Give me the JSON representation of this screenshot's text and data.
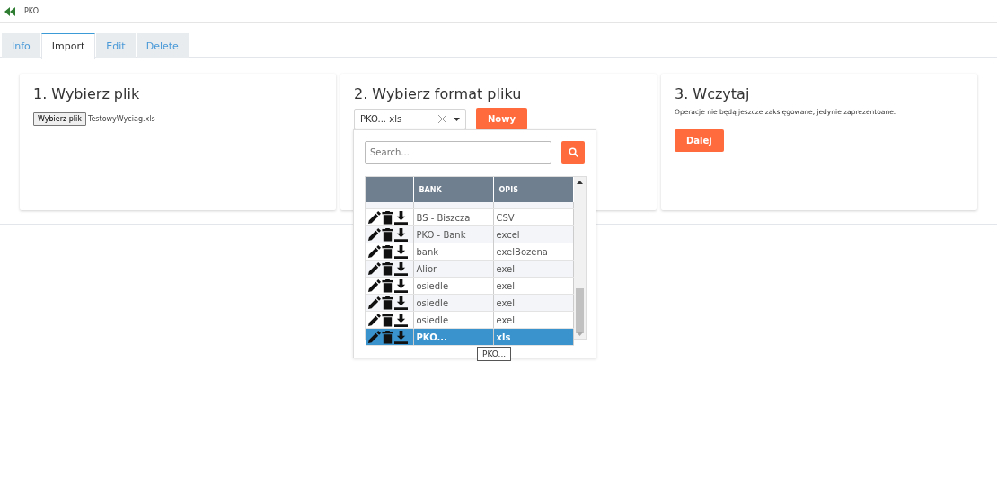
{
  "header": {
    "title": "PKO..."
  },
  "tabs": [
    {
      "label": "Info",
      "selected": false
    },
    {
      "label": "Import",
      "selected": true
    },
    {
      "label": "Edit",
      "selected": false
    },
    {
      "label": "Delete",
      "selected": false
    }
  ],
  "cards": [
    {
      "kind": "file",
      "title": "1. Wybierz plik",
      "button": "Wybierz plik",
      "file_name": "TestowyWyciag.xls"
    },
    {
      "kind": "format",
      "title": "2. Wybierz format pliku",
      "select_value": "PKO... xls",
      "button": "Nowy"
    },
    {
      "kind": "load",
      "title": "3. Wczytaj",
      "note": "Operacje nie będą jeszcze zaksięgowane, jedynie zaprezentoane.",
      "button": "Dalej"
    }
  ],
  "dropdown": {
    "search_placeholder": "Search...",
    "columns": [
      "BANK",
      "OPIS"
    ],
    "rows": [
      {
        "bank": "BS - Biszcza",
        "opis": "CSV",
        "selected": false
      },
      {
        "bank": "PKO - Bank",
        "opis": "excel",
        "selected": false
      },
      {
        "bank": "bank",
        "opis": "exelBozena",
        "selected": false
      },
      {
        "bank": "Alior",
        "opis": "exel",
        "selected": false
      },
      {
        "bank": "osiedle",
        "opis": "exel",
        "selected": false
      },
      {
        "bank": "osiedle",
        "opis": "exel",
        "selected": false
      },
      {
        "bank": "osiedle",
        "opis": "exel",
        "selected": false
      },
      {
        "bank": "PKO...",
        "opis": "xls",
        "selected": true
      }
    ],
    "tooltip": "PKO..."
  }
}
